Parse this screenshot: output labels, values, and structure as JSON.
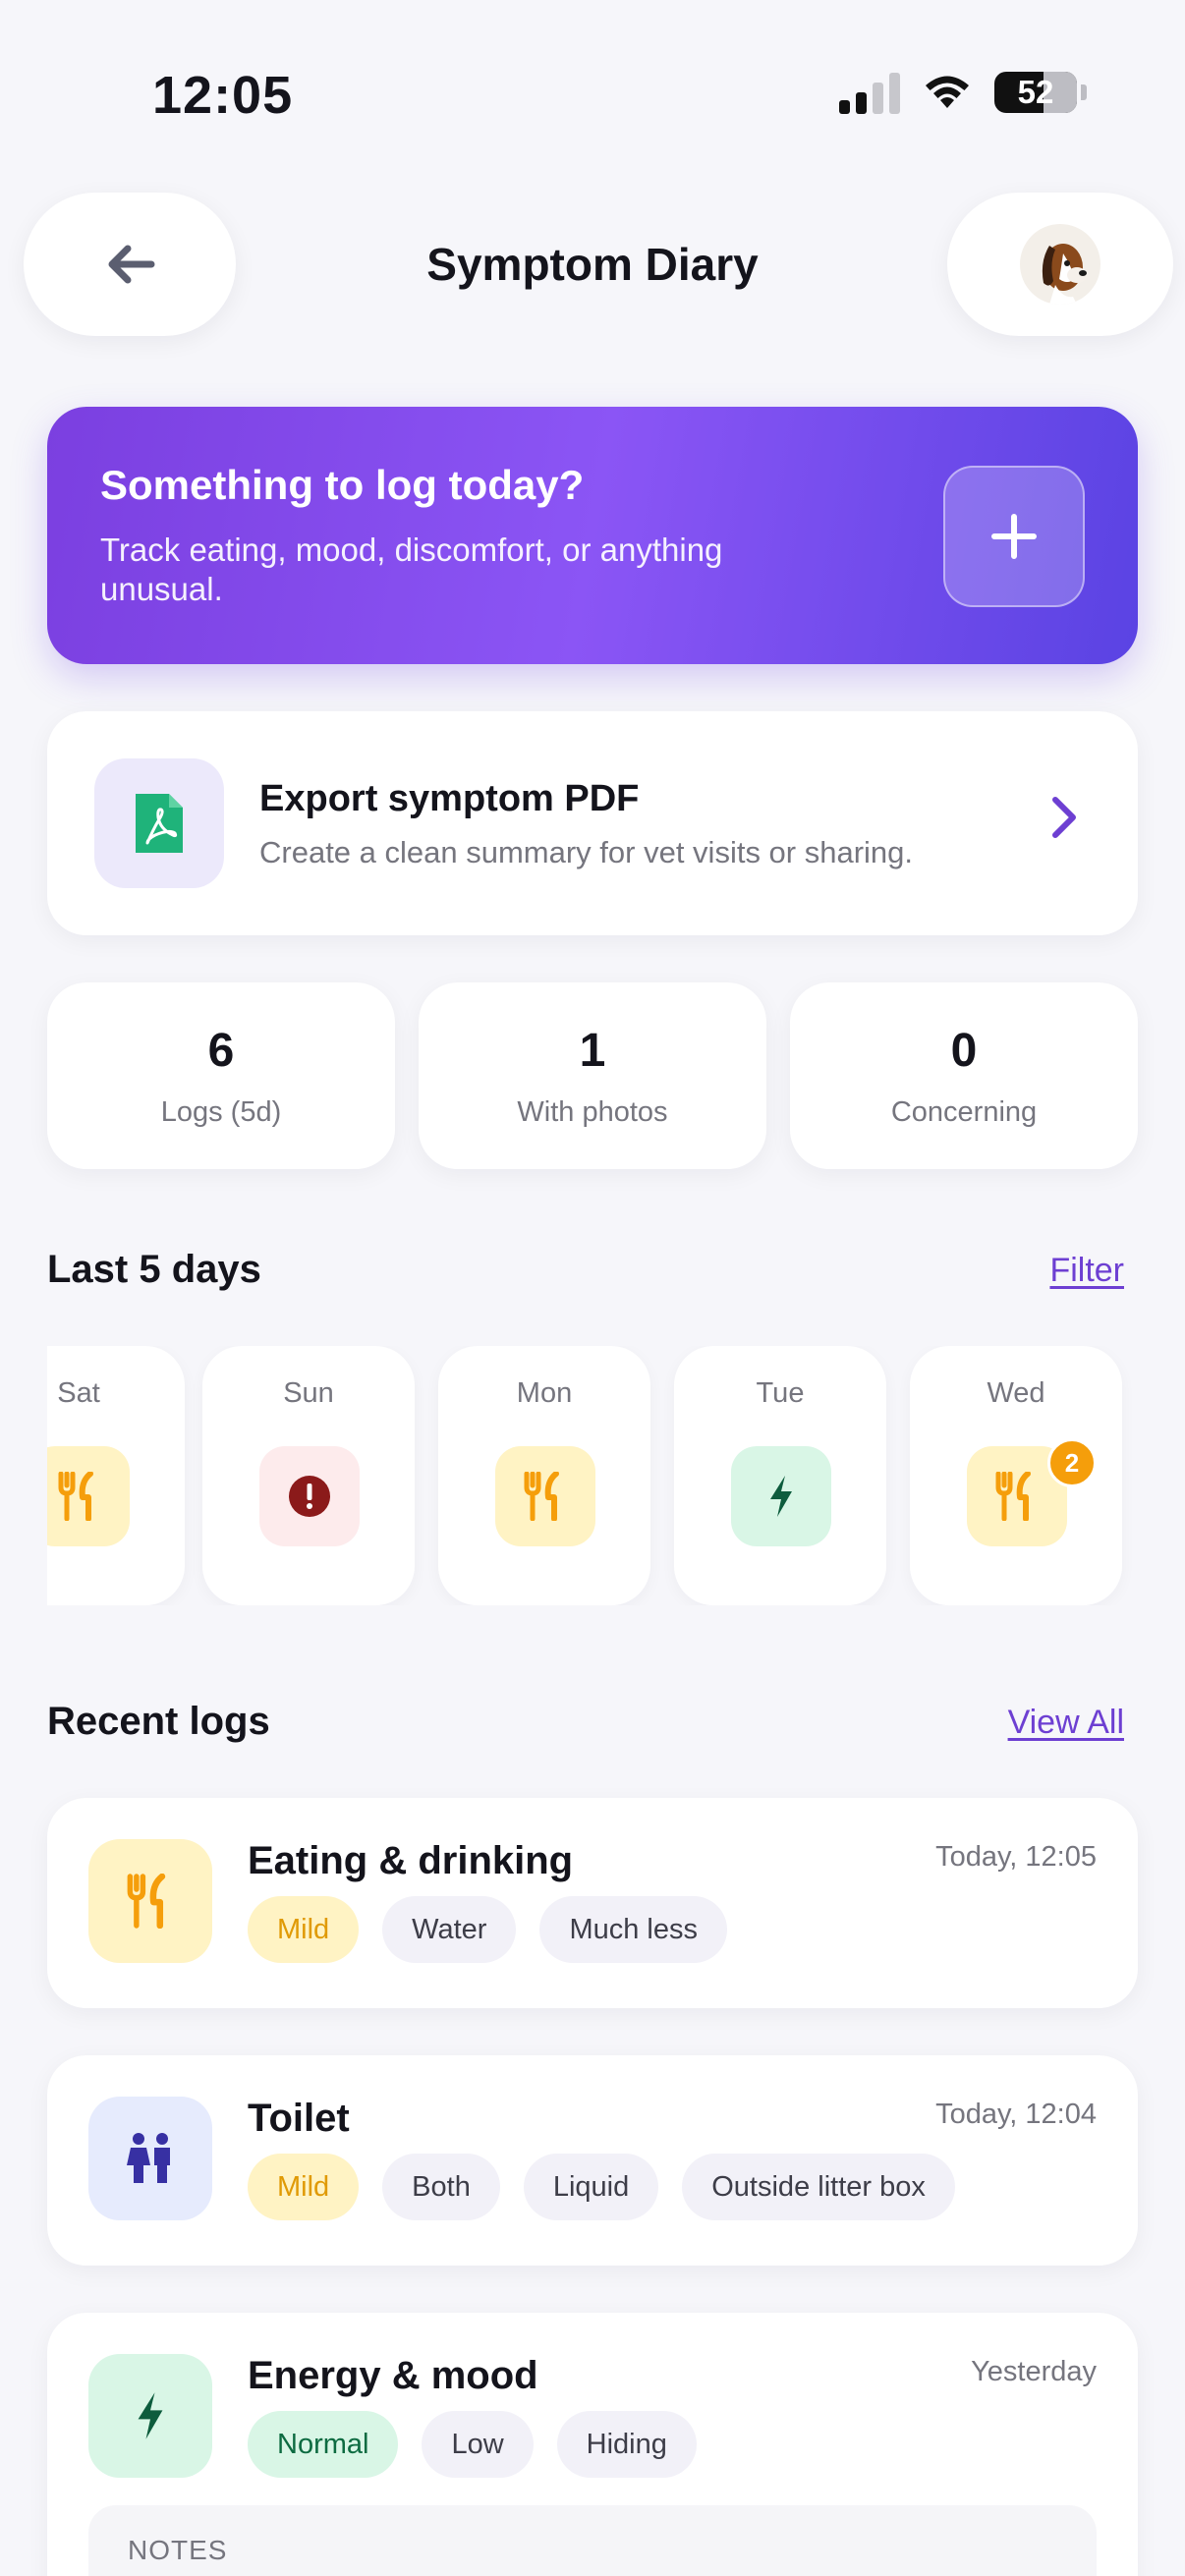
{
  "status_bar": {
    "time": "12:05",
    "battery": "52"
  },
  "header": {
    "title": "Symptom Diary"
  },
  "hero": {
    "title": "Something to log today?",
    "subtitle": "Track eating, mood, discomfort, or anything unusual."
  },
  "export": {
    "title": "Export symptom PDF",
    "subtitle": "Create a clean summary for vet visits or sharing."
  },
  "stats": [
    {
      "value": "6",
      "label": "Logs (5d)"
    },
    {
      "value": "1",
      "label": "With photos"
    },
    {
      "value": "0",
      "label": "Concerning"
    }
  ],
  "days_section": {
    "title": "Last 5 days",
    "filter_label": "Filter",
    "days": [
      {
        "label": "Sat",
        "icon": "fork-knife-icon",
        "tone": "yellow"
      },
      {
        "label": "Sun",
        "icon": "alert-circle-icon",
        "tone": "pink"
      },
      {
        "label": "Mon",
        "icon": "fork-knife-icon",
        "tone": "yellow"
      },
      {
        "label": "Tue",
        "icon": "lightning-icon",
        "tone": "green"
      },
      {
        "label": "Wed",
        "icon": "fork-knife-icon",
        "tone": "yellow",
        "badge": "2"
      }
    ]
  },
  "logs_section": {
    "title": "Recent logs",
    "view_all_label": "View All",
    "logs": [
      {
        "title": "Eating & drinking",
        "time": "Today, 12:05",
        "icon": "fork-knife-icon",
        "tone": "yellow",
        "chips": [
          "Mild",
          "Water",
          "Much less"
        ]
      },
      {
        "title": "Toilet",
        "time": "Today, 12:04",
        "icon": "restroom-icon",
        "tone": "blue",
        "chips": [
          "Mild",
          "Both",
          "Liquid",
          "Outside litter box"
        ]
      },
      {
        "title": "Energy & mood",
        "time": "Yesterday",
        "icon": "lightning-icon",
        "tone": "green",
        "chips": [
          "Normal",
          "Low",
          "Hiding"
        ],
        "notes_label": "NOTES"
      }
    ]
  },
  "colors": {
    "accent": "#6d3fd2",
    "hero_gradient": [
      "#7b3fe0",
      "#8b55f5",
      "#5a43e3"
    ],
    "mild": "#e09a05",
    "normal": "#0d6b41",
    "pdf_green": "#1fb37a",
    "alert_red": "#8b1a1a"
  }
}
